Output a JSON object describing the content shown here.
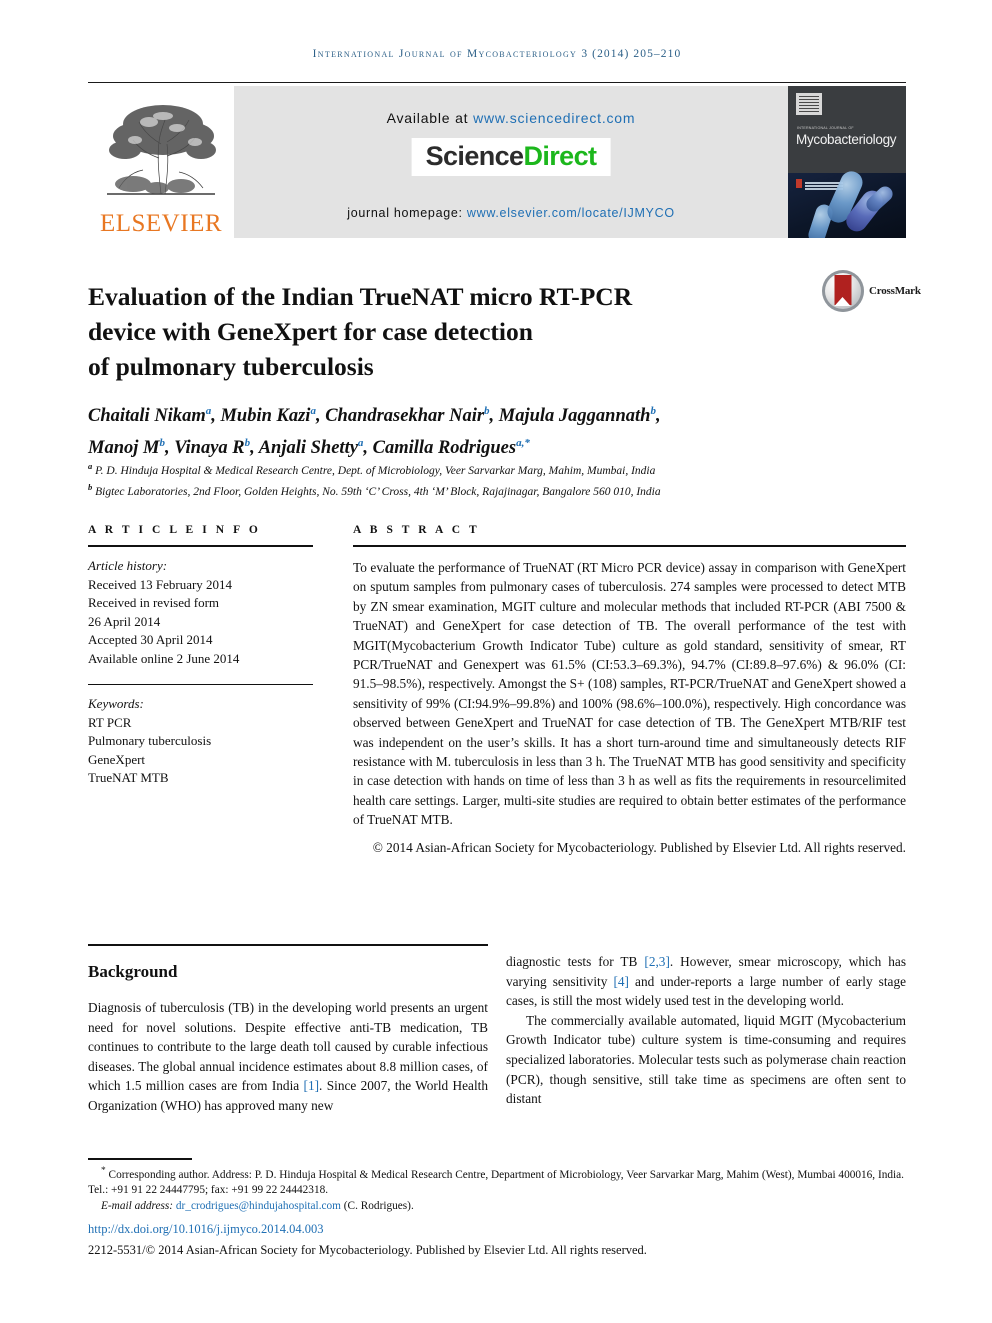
{
  "running_head": {
    "journal": "International Journal of Mycobacteriology",
    "volume_year_pages": "3 (2014) 205–210"
  },
  "masthead": {
    "publisher": "ELSEVIER",
    "available_at_label": "Available at",
    "available_at_url": "www.sciencedirect.com",
    "sciencedirect_part1": "Science",
    "sciencedirect_part2": "Direct",
    "homepage_label": "journal homepage:",
    "homepage_url": "www.elsevier.com/locate/IJMYCO",
    "cover_kicker": "INTERNATIONAL JOURNAL OF",
    "cover_title": "Mycobacteriology"
  },
  "article": {
    "title_line1": "Evaluation of the Indian TrueNAT micro RT-PCR",
    "title_line2": "device with GeneXpert for case detection",
    "title_line3": "of pulmonary tuberculosis",
    "crossmark_label": "CrossMark"
  },
  "authors": {
    "line1_names": [
      {
        "name": "Chaitali Nikam",
        "sup": "a"
      },
      {
        "name": "Mubin Kazi",
        "sup": "a"
      },
      {
        "name": "Chandrasekhar Nair",
        "sup": "b"
      },
      {
        "name": "Majula Jaggannath",
        "sup": "b"
      }
    ],
    "line2_names": [
      {
        "name": "Manoj M",
        "sup": "b"
      },
      {
        "name": "Vinaya R",
        "sup": "b"
      },
      {
        "name": "Anjali Shetty",
        "sup": "a"
      },
      {
        "name": "Camilla Rodrigues",
        "sup": "a,*"
      }
    ],
    "affiliations": [
      {
        "marker": "a",
        "text": "P. D. Hinduja Hospital & Medical Research Centre, Dept. of Microbiology, Veer Sarvarkar Marg, Mahim, Mumbai, India"
      },
      {
        "marker": "b",
        "text": "Bigtec Laboratories, 2nd Floor, Golden Heights, No. 59th ‘C’ Cross, 4th ‘M’ Block, Rajajinagar, Bangalore 560 010, India"
      }
    ]
  },
  "article_info": {
    "heading": "A R T I C L E  I N F O",
    "history_label": "Article history:",
    "history": [
      "Received 13 February 2014",
      "Received in revised form",
      "26 April 2014",
      "Accepted 30 April 2014",
      "Available online 2 June 2014"
    ],
    "keywords_label": "Keywords:",
    "keywords": [
      "RT PCR",
      "Pulmonary tuberculosis",
      "GeneXpert",
      "TrueNAT MTB"
    ]
  },
  "abstract": {
    "heading": "A B S T R A C T",
    "text": "To evaluate the performance of TrueNAT (RT Micro PCR device) assay in comparison with GeneXpert on sputum samples from pulmonary cases of tuberculosis. 274 samples were processed to detect MTB by ZN smear examination, MGIT culture and molecular methods that included RT-PCR (ABI 7500 & TrueNAT) and GeneXpert for case detection of TB. The overall performance of the test with MGIT(Mycobacterium Growth Indicator Tube) culture as gold standard, sensitivity of smear, RT PCR/TrueNAT and Genexpert was 61.5% (CI:53.3–69.3%), 94.7% (CI:89.8–97.6%) & 96.0% (CI: 91.5–98.5%), respectively. Amongst the S+ (108) samples, RT-PCR/TrueNAT and GeneXpert showed a sensitivity of 99% (CI:94.9%–99.8%) and 100% (98.6%–100.0%), respectively. High concordance was observed between GeneXpert and TrueNAT for case detection of TB. The GeneXpert MTB/RIF test was independent on the user’s skills. It has a short turn-around time and simultaneously detects RIF resistance with M. tuberculosis in less than 3 h. The TrueNAT MTB has good sensitivity and specificity in case detection with hands on time of less than 3 h as well as fits the requirements in resourcelimited health care settings. Larger, multi-site studies are required to obtain better estimates of the performance of TrueNAT MTB.",
    "copyright": "© 2014 Asian-African Society for Mycobacteriology. Published by Elsevier Ltd. All rights reserved."
  },
  "background": {
    "heading": "Background",
    "left_para_1_a": "Diagnosis of tuberculosis (TB) in the developing world presents an urgent need for novel solutions. Despite effective anti-TB medication, TB continues to contribute to the large death toll caused by curable infectious diseases. The global annual incidence estimates about 8.8 million cases, of which 1.5 million cases are from India ",
    "left_ref_1": "[1]",
    "left_para_1_b": ". Since 2007, the World Health Organization (WHO) has approved many new",
    "right_para_1_a": "diagnostic tests for TB ",
    "right_ref_23": "[2,3]",
    "right_para_1_b": ". However, smear microscopy, which has varying sensitivity ",
    "right_ref_4": "[4]",
    "right_para_1_c": " and under-reports a large number of early stage cases, is still the most widely used test in the developing world.",
    "right_para_2": "The commercially available automated, liquid MGIT (Mycobacterium Growth Indicator tube) culture system is time-consuming and requires specialized laboratories. Molecular tests such as polymerase chain reaction (PCR), though sensitive, still take time as specimens are often sent to distant"
  },
  "footer": {
    "corresponding_marker": "*",
    "corresponding_text": "Corresponding author. Address: P. D. Hinduja Hospital & Medical Research Centre, Department of Microbiology, Veer Sarvarkar Marg, Mahim (West), Mumbai 400016, India. Tel.: +91 91 22 24447795; fax: +91 99 22 24442318.",
    "email_label": "E-mail address:",
    "email": "dr_crodrigues@hindujahospital.com",
    "email_owner": "(C. Rodrigues).",
    "doi": "http://dx.doi.org/10.1016/j.ijmyco.2014.04.003",
    "issn_line": "2212-5531/© 2014 Asian-African Society for Mycobacteriology. Published by Elsevier Ltd. All rights reserved."
  },
  "colors": {
    "link": "#1f6fb4",
    "running_head": "#2b5f87",
    "elsevier_orange": "#E87722",
    "sciencedirect_green": "#1CB71C",
    "crossmark_red": "#B0211F"
  }
}
